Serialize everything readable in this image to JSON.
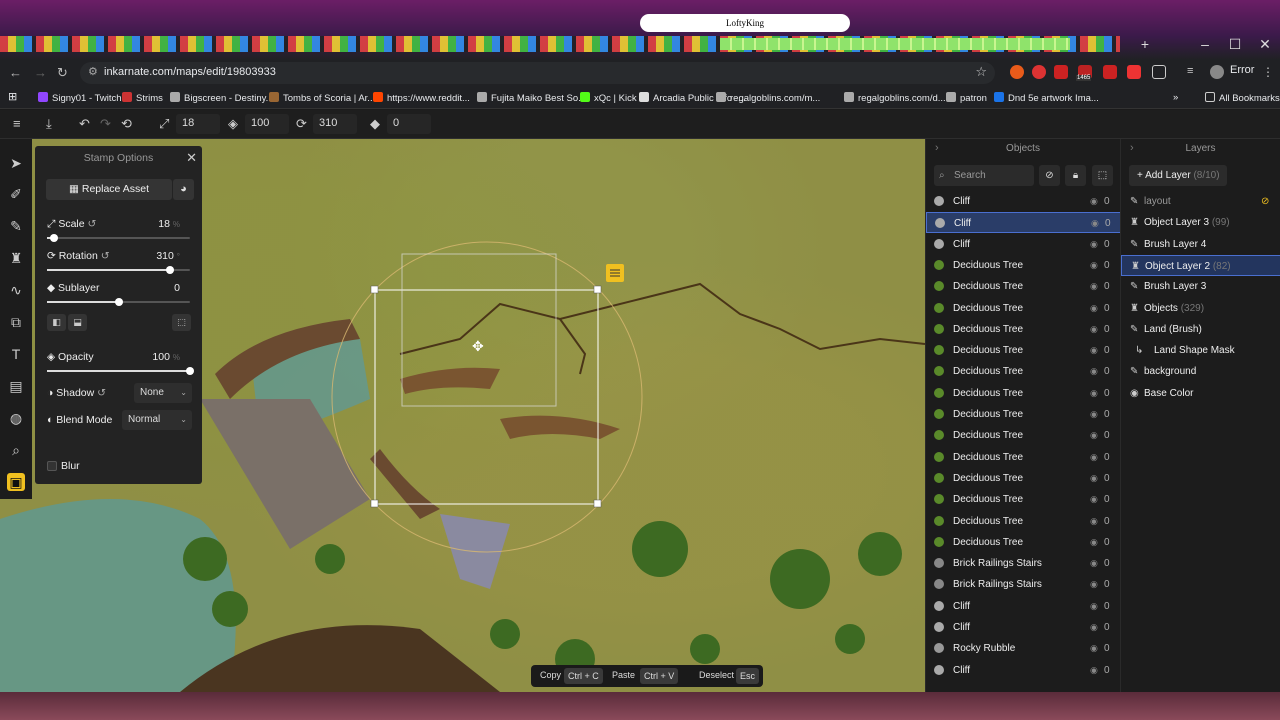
{
  "browser": {
    "banner": "LoftyKing",
    "url": "inkarnate.com/maps/edit/19803933",
    "error_label": "Error",
    "all_bookmarks": "All Bookmarks",
    "extension_badge": "1465",
    "bookmarks": [
      {
        "label": "Signy01 - Twitch",
        "color": "#9146ff"
      },
      {
        "label": "Strims",
        "color": "#c33"
      },
      {
        "label": "Bigscreen - Destiny...",
        "color": "#aaa"
      },
      {
        "label": "Tombs of Scoria | Ar...",
        "color": "#963"
      },
      {
        "label": "https://www.reddit...",
        "color": "#ff4500"
      },
      {
        "label": "Fujita Maiko Best So...",
        "color": "#aaa"
      },
      {
        "label": "xQc | Kick",
        "color": "#53fc18"
      },
      {
        "label": "Arcadia Public Info -...",
        "color": "#ddd"
      },
      {
        "label": "regalgoblins.com/m...",
        "color": "#aaa"
      },
      {
        "label": "regalgoblins.com/d...",
        "color": "#aaa"
      },
      {
        "label": "patron",
        "color": "#aaa"
      },
      {
        "label": "Dnd 5e artwork Ima...",
        "color": "#1a73e8"
      }
    ]
  },
  "toolbar": {
    "scale": "18",
    "opacity": "100",
    "rotation": "310",
    "sublayer": "0"
  },
  "stamp_options": {
    "title": "Stamp Options",
    "replace_asset": "Replace Asset",
    "scale_label": "Scale",
    "scale_value": "18",
    "scale_unit": "%",
    "scale_fraction": 0.05,
    "rotation_label": "Rotation",
    "rotation_value": "310",
    "rotation_unit": "°",
    "rotation_fraction": 0.86,
    "sublayer_label": "Sublayer",
    "sublayer_value": "0",
    "sublayer_fraction": 0.5,
    "opacity_label": "Opacity",
    "opacity_value": "100",
    "opacity_unit": "%",
    "opacity_fraction": 1.0,
    "shadow_label": "Shadow",
    "shadow_value": "None",
    "blend_label": "Blend Mode",
    "blend_value": "Normal",
    "blur_label": "Blur"
  },
  "objects_panel": {
    "title": "Objects",
    "search_placeholder": "Search",
    "items": [
      {
        "name": "Cliff",
        "count": "0",
        "icon_color": "#aaa"
      },
      {
        "name": "Cliff",
        "count": "0",
        "icon_color": "#aaa"
      },
      {
        "name": "Cliff",
        "count": "0",
        "icon_color": "#aaa"
      },
      {
        "name": "Deciduous Tree",
        "count": "0",
        "icon_color": "#5a8a2a"
      },
      {
        "name": "Deciduous Tree",
        "count": "0",
        "icon_color": "#5a8a2a"
      },
      {
        "name": "Deciduous Tree",
        "count": "0",
        "icon_color": "#5a8a2a"
      },
      {
        "name": "Deciduous Tree",
        "count": "0",
        "icon_color": "#5a8a2a"
      },
      {
        "name": "Deciduous Tree",
        "count": "0",
        "icon_color": "#5a8a2a"
      },
      {
        "name": "Deciduous Tree",
        "count": "0",
        "icon_color": "#5a8a2a"
      },
      {
        "name": "Deciduous Tree",
        "count": "0",
        "icon_color": "#5a8a2a"
      },
      {
        "name": "Deciduous Tree",
        "count": "0",
        "icon_color": "#5a8a2a"
      },
      {
        "name": "Deciduous Tree",
        "count": "0",
        "icon_color": "#5a8a2a"
      },
      {
        "name": "Deciduous Tree",
        "count": "0",
        "icon_color": "#5a8a2a"
      },
      {
        "name": "Deciduous Tree",
        "count": "0",
        "icon_color": "#5a8a2a"
      },
      {
        "name": "Deciduous Tree",
        "count": "0",
        "icon_color": "#5a8a2a"
      },
      {
        "name": "Deciduous Tree",
        "count": "0",
        "icon_color": "#5a8a2a"
      },
      {
        "name": "Deciduous Tree",
        "count": "0",
        "icon_color": "#5a8a2a"
      },
      {
        "name": "Brick Railings Stairs",
        "count": "0",
        "icon_color": "#888"
      },
      {
        "name": "Brick Railings Stairs",
        "count": "0",
        "icon_color": "#888"
      },
      {
        "name": "Cliff",
        "count": "0",
        "icon_color": "#aaa"
      },
      {
        "name": "Cliff",
        "count": "0",
        "icon_color": "#aaa"
      },
      {
        "name": "Rocky Rubble",
        "count": "0",
        "icon_color": "#999"
      },
      {
        "name": "Cliff",
        "count": "0",
        "icon_color": "#aaa"
      }
    ]
  },
  "layers_panel": {
    "title": "Layers",
    "add_layer": "Add Layer",
    "add_layer_count": "(8/10)",
    "items": [
      {
        "name": "layout",
        "count": "",
        "icon": "✎"
      },
      {
        "name": "Object Layer 3",
        "count": "(99)",
        "icon": "♜"
      },
      {
        "name": "Brush Layer 4",
        "count": "",
        "icon": "✎"
      },
      {
        "name": "Object Layer 2",
        "count": "(82)",
        "icon": "♜"
      },
      {
        "name": "Brush Layer 3",
        "count": "",
        "icon": "✎"
      },
      {
        "name": "Objects",
        "count": "(329)",
        "icon": "♜"
      },
      {
        "name": "Land (Brush)",
        "count": "",
        "icon": "✎"
      },
      {
        "name": "Land Shape Mask",
        "count": "",
        "icon": "↳"
      },
      {
        "name": "background",
        "count": "",
        "icon": "✎"
      },
      {
        "name": "Base Color",
        "count": "",
        "icon": "◉"
      }
    ]
  },
  "action_bar": {
    "copy": "Copy",
    "copy_key": "Ctrl + C",
    "paste": "Paste",
    "paste_key": "Ctrl + V",
    "deselect": "Deselect",
    "deselect_key": "Esc"
  },
  "colors": {
    "accent": "#f0c020",
    "selection": "#4a6fd0"
  }
}
